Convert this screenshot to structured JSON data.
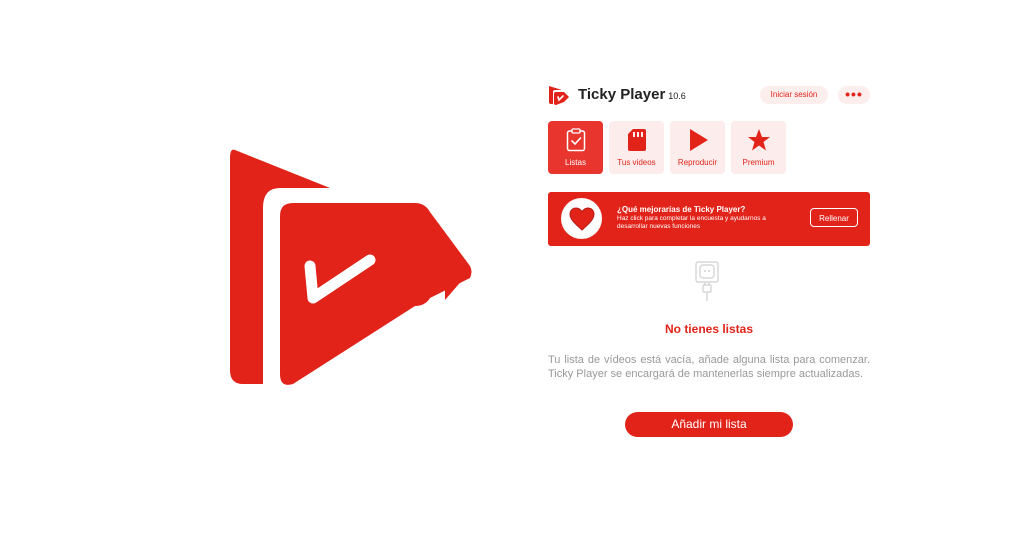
{
  "header": {
    "title": "Ticky Player",
    "version": "10.6",
    "login_label": "Iniciar sesión",
    "more_label": "•••"
  },
  "tabs": [
    {
      "label": "Listas",
      "icon": "clipboard-check-icon",
      "active": true
    },
    {
      "label": "Tus videos",
      "icon": "sd-card-icon",
      "active": false
    },
    {
      "label": "Reproducir",
      "icon": "play-icon",
      "active": false
    },
    {
      "label": "Premium",
      "icon": "star-icon",
      "active": false
    }
  ],
  "banner": {
    "title": "¿Qué mejorarías de Ticky Player?",
    "description": "Haz click para completar la encuesta y ayudarnos a desarrollar nuevas funciones",
    "button_label": "Rellenar",
    "icon": "heart-icon"
  },
  "empty_state": {
    "icon": "unplugged-icon",
    "title": "No tienes listas",
    "description": "Tu lista de vídeos está vacía, añade alguna lista para comenzar. Ticky Player se encargará de mantenerlas siempre actualizadas.",
    "button_label": "Añadir mi lista"
  },
  "colors": {
    "brand_red": "#e2231a",
    "light_red": "#fdecec",
    "text_gray": "#999999"
  }
}
